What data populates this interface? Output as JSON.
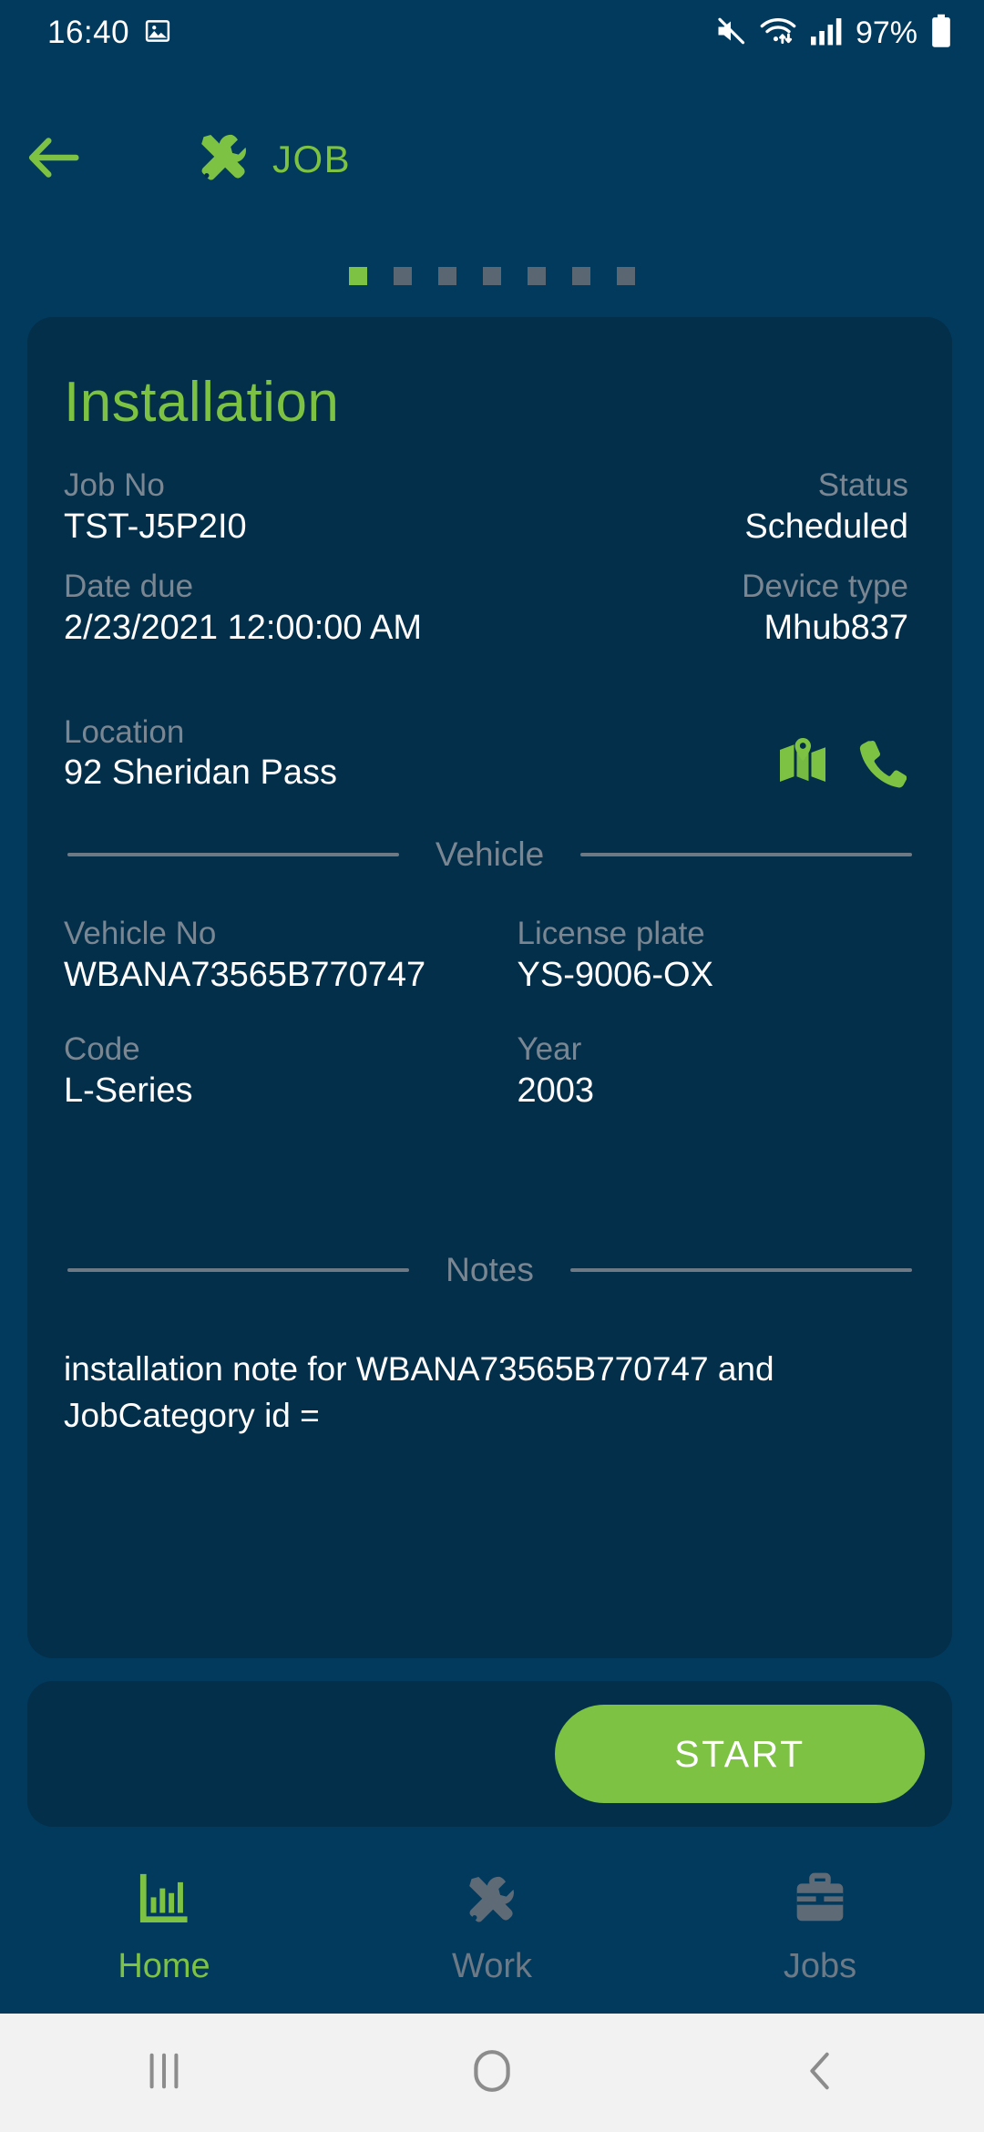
{
  "status_bar": {
    "time": "16:40",
    "battery_percent": "97%",
    "icons": [
      "image-icon",
      "mute-icon",
      "wifi-icon",
      "signal-icon",
      "battery-icon"
    ]
  },
  "app_bar": {
    "back_icon": "arrow-left-icon",
    "brand_icon": "tools-icon",
    "title": "JOB"
  },
  "pager": {
    "total": 7,
    "active_index": 0
  },
  "job_card": {
    "title": "Installation",
    "fields": {
      "job_no_label": "Job No",
      "job_no_value": "TST-J5P2I0",
      "status_label": "Status",
      "status_value": "Scheduled",
      "date_due_label": "Date due",
      "date_due_value": "2/23/2021 12:00:00 AM",
      "device_type_label": "Device type",
      "device_type_value": "Mhub837",
      "location_label": "Location",
      "location_value": "92 Sheridan Pass",
      "map_icon": "map-icon",
      "phone_icon": "phone-icon"
    },
    "vehicle_section": {
      "heading": "Vehicle",
      "vehicle_no_label": "Vehicle No",
      "vehicle_no_value": "WBANA73565B770747",
      "license_plate_label": "License plate",
      "license_plate_value": "YS-9006-OX",
      "code_label": "Code",
      "code_value": "L-Series",
      "year_label": "Year",
      "year_value": "2003"
    },
    "notes_section": {
      "heading": "Notes",
      "text": "installation note for WBANA73565B770747 and JobCategory id ="
    }
  },
  "action_panel": {
    "start_label": "START"
  },
  "bottom_nav": {
    "items": [
      {
        "label": "Home",
        "icon": "bar-chart-icon",
        "active": true
      },
      {
        "label": "Work",
        "icon": "tools-icon",
        "active": false
      },
      {
        "label": "Jobs",
        "icon": "briefcase-icon",
        "active": false
      }
    ]
  },
  "system_nav": {
    "recents_icon": "recents-icon",
    "home_icon": "home-circle-icon",
    "back_icon": "chevron-left-icon"
  },
  "colors": {
    "background": "#023a5e",
    "card": "#032f4a",
    "accent_green": "#7dc242",
    "label_gray": "#7a8793",
    "text_white": "#ffffff",
    "sysnav_bg": "#f2f2f2"
  }
}
